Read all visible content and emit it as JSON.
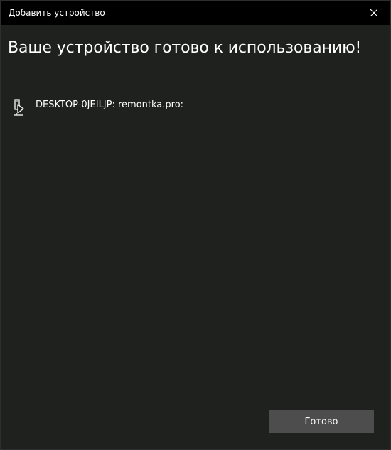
{
  "window": {
    "title": "Добавить устройство",
    "close_icon": "close-icon"
  },
  "main": {
    "heading": "Ваше устройство готово к использованию!",
    "device": {
      "icon": "display-device-icon",
      "label": "DESKTOP-0JEILJP: remontka.pro:"
    }
  },
  "footer": {
    "done_label": "Готово"
  },
  "colors": {
    "titlebar": "#000000",
    "background": "#1e211d",
    "button": "#4d4d4d",
    "text": "#ffffff"
  }
}
